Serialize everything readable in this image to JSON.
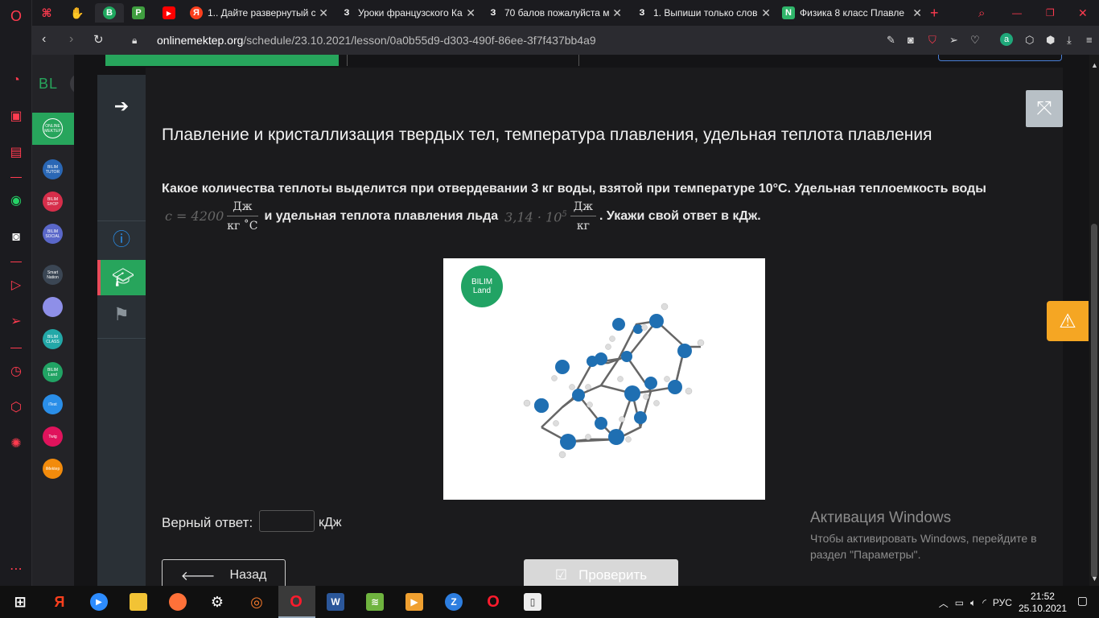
{
  "browser": {
    "tabs": [
      {
        "title": "",
        "favicon": "gamepad-icon",
        "color": "#1b1b1f"
      },
      {
        "title": "",
        "favicon": "hand-icon",
        "color": "#1b1b1f"
      },
      {
        "title": "",
        "favicon": "B",
        "color": "#1fa85f",
        "active": true
      },
      {
        "title": "",
        "favicon": "P",
        "color": "#3f9e3f"
      },
      {
        "title": "",
        "favicon": "youtube-icon",
        "color": "#ff0000"
      },
      {
        "title": "1.. Дайте развернутый с",
        "favicon": "Я",
        "color": "#fc3f1d"
      },
      {
        "title": "Уроки французского Ка",
        "favicon": "З",
        "color": "#1b1b1f"
      },
      {
        "title": "70 балов пожалуйста м",
        "favicon": "З",
        "color": "#1b1b1f"
      },
      {
        "title": "1. Выпиши только слов",
        "favicon": "З",
        "color": "#1b1b1f"
      },
      {
        "title": "Физика 8 класс Плавле",
        "favicon": "N",
        "color": "#2fb56a"
      }
    ],
    "url_host": "onlinemektep.org",
    "url_path": "/schedule/23.10.2021/lesson/0a0b55d9-d303-490f-86ee-3f7f437bb4a9"
  },
  "sidebar": {
    "logo": "BL",
    "apps": [
      {
        "label": "ONLINE MEKTEP",
        "color": "#27a55c"
      },
      {
        "label": "BILIM TUTOR",
        "color": "#2a67b5"
      },
      {
        "label": "BILIM SHOP",
        "color": "#d62e4a"
      },
      {
        "label": "BILIM SOCIAL",
        "color": "#5a67c9"
      },
      {
        "label": "Smart Nation",
        "color": "#3b4654"
      },
      {
        "label": "",
        "color": "#8e8fe8"
      },
      {
        "label": "BILIM CLASS",
        "color": "#23a8a8"
      },
      {
        "label": "BILIM Land",
        "color": "#21a364"
      },
      {
        "label": "iTest",
        "color": "#2a8ee8"
      },
      {
        "label": "Twig",
        "color": "#e0135c"
      },
      {
        "label": "iMektep",
        "color": "#f28b0c"
      }
    ]
  },
  "lesson": {
    "title": "Плавление и кристаллизация твердых тел, температура плавления, удельная теплота плавления",
    "question_part1": "Какое количества теплоты выделится при отвердевании 3 кг воды, взятой при температуре 10°С. Удельная теплоемкость воды",
    "formula_c": "c = 4200",
    "frac1_num": "Дж",
    "frac1_den": "кг ˚C",
    "question_part2": "и удельная теплота плавления льда",
    "formula_lambda": "3,14 · 10",
    "formula_exp": "5",
    "frac2_num": "Дж",
    "frac2_den": "кг",
    "question_part3": ". Укажи свой ответ в кДж.",
    "figure_logo_line1": "BILIM",
    "figure_logo_line2": "Land",
    "answer_label": "Верный ответ:",
    "answer_value": "",
    "answer_unit": "кДж",
    "back_label": "Назад",
    "check_label": "Проверить"
  },
  "activation": {
    "heading": "Активация Windows",
    "line1": "Чтобы активировать Windows, перейдите в",
    "line2": "раздел \"Параметры\"."
  },
  "taskbar": {
    "lang": "РУС",
    "time": "21:52",
    "date": "25.10.2021"
  },
  "colors": {
    "accent_green": "#27a55c",
    "warning": "#f5a623",
    "molecule_blue": "#1f6fb2"
  }
}
